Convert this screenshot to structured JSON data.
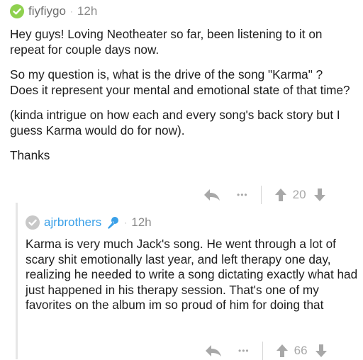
{
  "comments": [
    {
      "username": "fiyfiygo",
      "time": "12h",
      "paragraphs": [
        "Hey guys! Loving Neotheater so far, been listening to it on repeat for couple days now.",
        "So my question is, what is the drive of the song \"Karma\" ? Does it represent your mental and emotional state of that time?",
        "(kinda intrigue on how each and every song's back story but I guess Karma would do for now).",
        "Thanks"
      ],
      "votes": "20",
      "more": "•••"
    },
    {
      "username": "ajrbrothers",
      "time": "12h",
      "paragraphs": [
        "Karma is very much Jack's song. He went through a lot of scary shit emotionally last year, and left therapy one day, realizing he needed to write a song dictating exactly what had just happened in his therapy session. That's one of my favorites on the album im so proud of him for doing that"
      ],
      "votes": "66",
      "more": "•••"
    }
  ],
  "colors": {
    "verified": "#8fd14f",
    "link": "#3aa0e8",
    "muted": "#a8a8a8"
  },
  "icons": [
    "check-badge-icon",
    "microphone-icon",
    "reply-icon",
    "more-icon",
    "upvote-icon",
    "downvote-icon"
  ]
}
